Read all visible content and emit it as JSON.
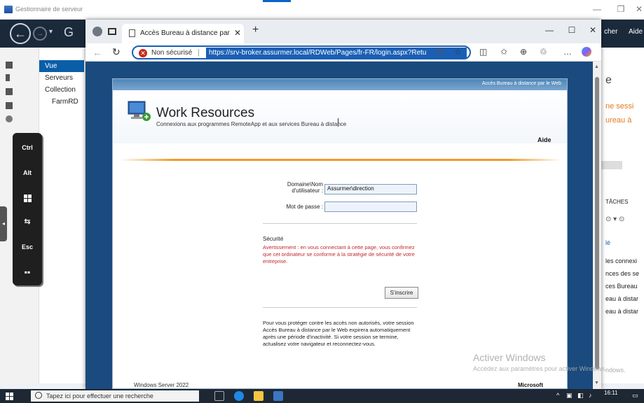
{
  "server_manager": {
    "title": "Gestionnaire de serveur",
    "nav_letter": "G",
    "menu_right": [
      "cher",
      "Aide"
    ],
    "tree": [
      "Vue d'ensem",
      "Serveurs",
      "Collection",
      "FarmRD"
    ],
    "right_panel": [
      "e",
      "ne sessi",
      "ureau à",
      "TÂCHES",
      "lé",
      "les connexi",
      "nces des se",
      "ces Bureau",
      "eau à distar",
      "eau à distar",
      "ndows."
    ]
  },
  "remote_toolbar": {
    "buttons": [
      "Ctrl",
      "Alt",
      "",
      "",
      "Esc",
      ""
    ]
  },
  "browser": {
    "tab_title": "Accès Bureau à distance par le W",
    "security_label": "Non sécurisé",
    "url": "https://srv-broker.assurmer.local/RDWeb/Pages/fr-FR/login.aspx?Retu",
    "reader_icon_text": "Aᴬ"
  },
  "rdweb": {
    "top_bar_text": "Accès Bureau à distance par le Web",
    "title": "Work Resources",
    "subtitle": "Connexions aux programmes RemoteApp et aux services Bureau à distance",
    "help": "Aide",
    "username_label_line1": "Domaine\\Nom",
    "username_label_line2": "d'utilisateur :",
    "username_value": "Assurmer\\direction",
    "password_label": "Mot de passe :",
    "password_value": "",
    "security_title": "Sécurité",
    "security_warning": "Avertissement : en vous connectant à cette page, vous confirmez que cet ordinateur se conforme à la stratégie de sécurité de votre entreprise.",
    "signin_button": "S'inscrire",
    "info_text": "Pour vous protéger contre les accès non autorisés, votre session Accès Bureau à distance par le Web expirera automatiquement après une période d'inactivité. Si votre session se termine, actualisez votre navigateur et reconnectez-vous.",
    "footer_left": "Windows Server 2022",
    "footer_right": "Microsoft"
  },
  "watermark": {
    "line1": "Activer Windows",
    "line2": "Accédez aux paramètres pour activer Windows."
  },
  "taskbar": {
    "search_placeholder": "Tapez ici pour effectuer une recherche",
    "time": "16:11"
  },
  "colors": {
    "accent_blue": "#1a5fb4",
    "warning_red": "#c0282d",
    "orange_rule": "#f09a2a"
  }
}
